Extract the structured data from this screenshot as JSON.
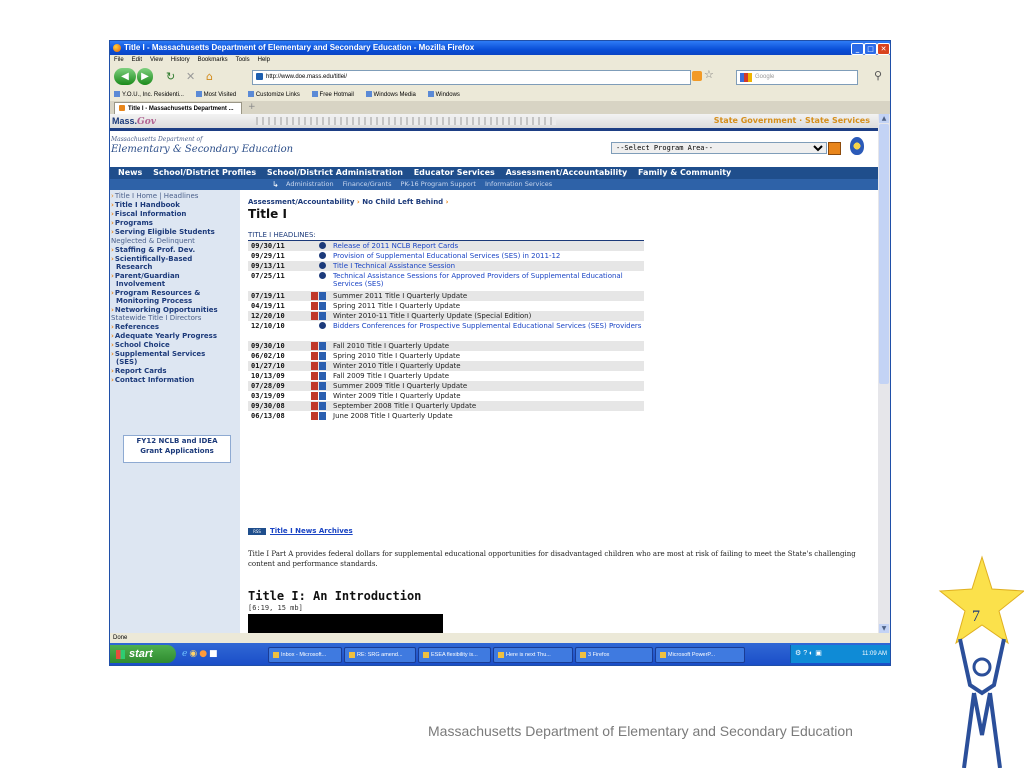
{
  "window": {
    "title": "Title I - Massachusetts Department of Elementary and Secondary Education - Mozilla Firefox"
  },
  "menu": [
    "File",
    "Edit",
    "View",
    "History",
    "Bookmarks",
    "Tools",
    "Help"
  ],
  "address": {
    "url": "http://www.doe.mass.edu/titlei/",
    "search_placeholder": "Google"
  },
  "bookmarks": [
    "Y.O.U., Inc. Residenti...",
    "Most Visited",
    "Customize Links",
    "Free Hotmail",
    "Windows Media",
    "Windows"
  ],
  "tab": {
    "label": "Title I - Massachusetts Department ..."
  },
  "site": {
    "logo_text": "Mass.",
    "logo_suffix": "Gov",
    "gov_links": "State Government · State Services",
    "dept_small": "Massachusetts Department of",
    "dept_name": "Elementary & Secondary Education",
    "program_select": "--Select Program Area--",
    "main_nav": [
      "News",
      "School/District Profiles",
      "School/District Administration",
      "Educator Services",
      "Assessment/Accountability",
      "Family & Community"
    ],
    "sub_nav": [
      "Administration",
      "Finance/Grants",
      "PK-16 Program Support",
      "Information Services"
    ]
  },
  "sidebar": {
    "items": [
      {
        "label": "Title I Home | Headlines",
        "style": "plain"
      },
      {
        "label": "Title I Handbook",
        "style": "bold"
      },
      {
        "label": "Fiscal Information",
        "style": "bold"
      },
      {
        "label": "Programs",
        "style": "bold"
      },
      {
        "label": "Serving Eligible Students",
        "style": "bold"
      },
      {
        "label": "Neglected & Delinquent",
        "style": "plain-nocaret"
      },
      {
        "label": "Staffing & Prof. Dev.",
        "style": "bold"
      },
      {
        "label": "Scientifically-Based",
        "style": "bold"
      },
      {
        "label": "Research",
        "style": "cont"
      },
      {
        "label": "Parent/Guardian",
        "style": "bold"
      },
      {
        "label": "Involvement",
        "style": "cont"
      },
      {
        "label": "Program Resources &",
        "style": "bold"
      },
      {
        "label": "Monitoring Process",
        "style": "cont"
      },
      {
        "label": "Networking Opportunities",
        "style": "bold"
      },
      {
        "label": "Statewide Title I Directors",
        "style": "plain-nocaret"
      },
      {
        "label": "References",
        "style": "bold"
      },
      {
        "label": "Adequate Yearly Progress",
        "style": "bold"
      },
      {
        "label": "School Choice",
        "style": "bold"
      },
      {
        "label": "Supplemental Services",
        "style": "bold"
      },
      {
        "label": "(SES)",
        "style": "cont"
      },
      {
        "label": "Report Cards",
        "style": "bold"
      },
      {
        "label": "Contact Information",
        "style": "bold"
      }
    ],
    "grant_line1": "FY12 NCLB and IDEA",
    "grant_line2": "Grant Applications"
  },
  "content": {
    "crumb1": "Assessment/Accountability",
    "crumb2": "No Child Left Behind",
    "title": "Title I",
    "headlines_label": "TITLE I HEADLINES:",
    "headlines": [
      {
        "date": "09/30/11",
        "icon": "web",
        "text": "Release of 2011 NCLB Report Cards",
        "link": true
      },
      {
        "date": "09/29/11",
        "icon": "web",
        "text": "Provision of Supplemental Educational Services (SES) in 2011-12",
        "link": true
      },
      {
        "date": "09/13/11",
        "icon": "web",
        "text": "Title I Technical Assistance Session",
        "link": true
      },
      {
        "date": "07/25/11",
        "icon": "web",
        "text": "Technical Assistance Sessions for Approved Providers of Supplemental Educational Services (SES)",
        "link": true
      },
      {
        "date": "07/19/11",
        "icon": "pdfdoc",
        "text": "Summer 2011 Title I Quarterly Update",
        "link": false
      },
      {
        "date": "04/19/11",
        "icon": "pdfdoc",
        "text": "Spring 2011 Title I Quarterly Update",
        "link": false
      },
      {
        "date": "12/20/10",
        "icon": "pdfdoc",
        "text": "Winter 2010-11 Title I Quarterly Update (Special Edition)",
        "link": false
      },
      {
        "date": "12/10/10",
        "icon": "web",
        "text": "Bidders Conferences for Prospective Supplemental Educational Services (SES) Providers",
        "link": true
      },
      {
        "date": "09/30/10",
        "icon": "pdfdoc",
        "text": "Fall 2010 Title I Quarterly Update",
        "link": false
      },
      {
        "date": "06/02/10",
        "icon": "pdfdoc",
        "text": "Spring 2010 Title I Quarterly Update",
        "link": false
      },
      {
        "date": "01/27/10",
        "icon": "pdfdoc",
        "text": "Winter 2010 Title I Quarterly Update",
        "link": false
      },
      {
        "date": "10/13/09",
        "icon": "pdfdoc",
        "text": "Fall 2009 Title I Quarterly Update",
        "link": false
      },
      {
        "date": "07/28/09",
        "icon": "pdfdoc",
        "text": "Summer 2009 Title I Quarterly Update",
        "link": false
      },
      {
        "date": "03/19/09",
        "icon": "pdfdoc",
        "text": "Winter 2009 Title I Quarterly Update",
        "link": false
      },
      {
        "date": "09/30/08",
        "icon": "pdfdoc",
        "text": "September 2008 Title I Quarterly Update",
        "link": false
      },
      {
        "date": "06/13/08",
        "icon": "pdfdoc",
        "text": "June 2008 Title I Quarterly Update",
        "link": false
      }
    ],
    "rss_badge": "RSS",
    "archives_link": "Title I News Archives",
    "paragraph": "Title I Part A provides federal dollars for supplemental educational opportunities for disadvantaged children who are most at risk of failing to meet the State's challenging content and performance standards.",
    "intro_heading": "Title I: An Introduction",
    "intro_meta": "[6:19, 15 mb]"
  },
  "status": "Done",
  "taskbar": {
    "start": "start",
    "buttons": [
      "Inbox - Microsoft...",
      "RE: SRG amend...",
      "ESEA flexibility is...",
      "Here is next Thu...",
      "3 Firefox",
      "Microsoft PowerP..."
    ],
    "clock": "11:09 AM"
  },
  "slide": {
    "footer": "Massachusetts Department of Elementary and Secondary Education",
    "page_number": "7"
  },
  "colors": {
    "nav_blue": "#1f4e8c",
    "accent_orange": "#e8861b",
    "link_blue": "#1a44c4",
    "star_yellow": "#fbe14b"
  }
}
